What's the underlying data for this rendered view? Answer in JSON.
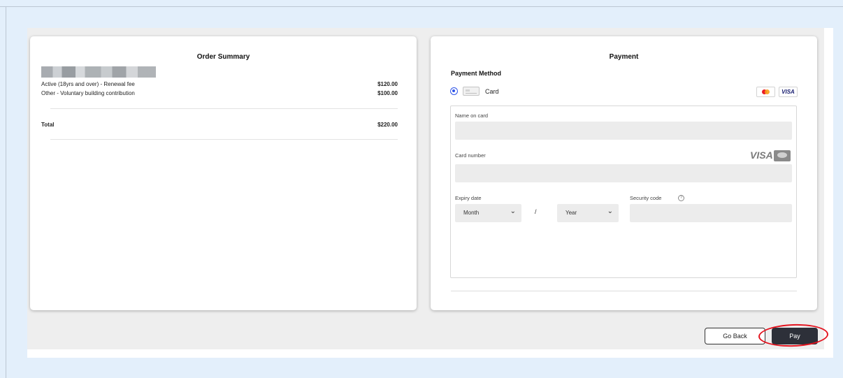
{
  "order_summary": {
    "title": "Order Summary",
    "items": [
      {
        "label": "Active (18yrs and over) - Renewal fee",
        "amount": "$120.00"
      },
      {
        "label": "Other - Voluntary building contribution",
        "amount": "$100.00"
      }
    ],
    "total_label": "Total",
    "total_amount": "$220.00"
  },
  "payment": {
    "title": "Payment",
    "method_title": "Payment Method",
    "method_option": "Card",
    "brands": [
      "mastercard-icon",
      "visa-icon"
    ],
    "fields": {
      "name_label": "Name on card",
      "number_label": "Card number",
      "expiry_label": "Expiry date",
      "month_value": "Month",
      "separator": "/",
      "year_value": "Year",
      "security_label": "Security code",
      "visa_text": "VISA",
      "visa_badge_text": "VISA"
    }
  },
  "actions": {
    "back_label": "Go Back",
    "pay_label": "Pay"
  },
  "colors": {
    "accent": "#2f54e8",
    "pay_button": "#2d3039",
    "annotation": "#e3141f",
    "page_bg": "#e3effb"
  }
}
